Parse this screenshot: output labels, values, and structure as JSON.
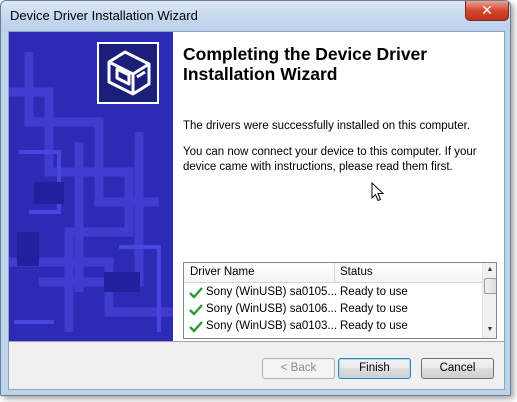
{
  "window": {
    "title": "Device Driver Installation Wizard",
    "close_glyph": "✕"
  },
  "wizard": {
    "heading": "Completing the Device Driver Installation Wizard",
    "message1": "The drivers were successfully installed on this computer.",
    "message2": "You can now connect your device to this computer. If your device came with instructions, please read them first."
  },
  "drivers_table": {
    "columns": [
      "Driver Name",
      "Status"
    ],
    "rows": [
      {
        "name": "Sony (WinUSB) sa0105...",
        "status": "Ready to use"
      },
      {
        "name": "Sony (WinUSB) sa0106...",
        "status": "Ready to use"
      },
      {
        "name": "Sony (WinUSB) sa0103...",
        "status": "Ready to use"
      }
    ]
  },
  "buttons": {
    "back": "< Back",
    "finish": "Finish",
    "cancel": "Cancel"
  },
  "colors": {
    "side_panel": "#2d2ab6",
    "check_mark": "#2e9a2e"
  }
}
